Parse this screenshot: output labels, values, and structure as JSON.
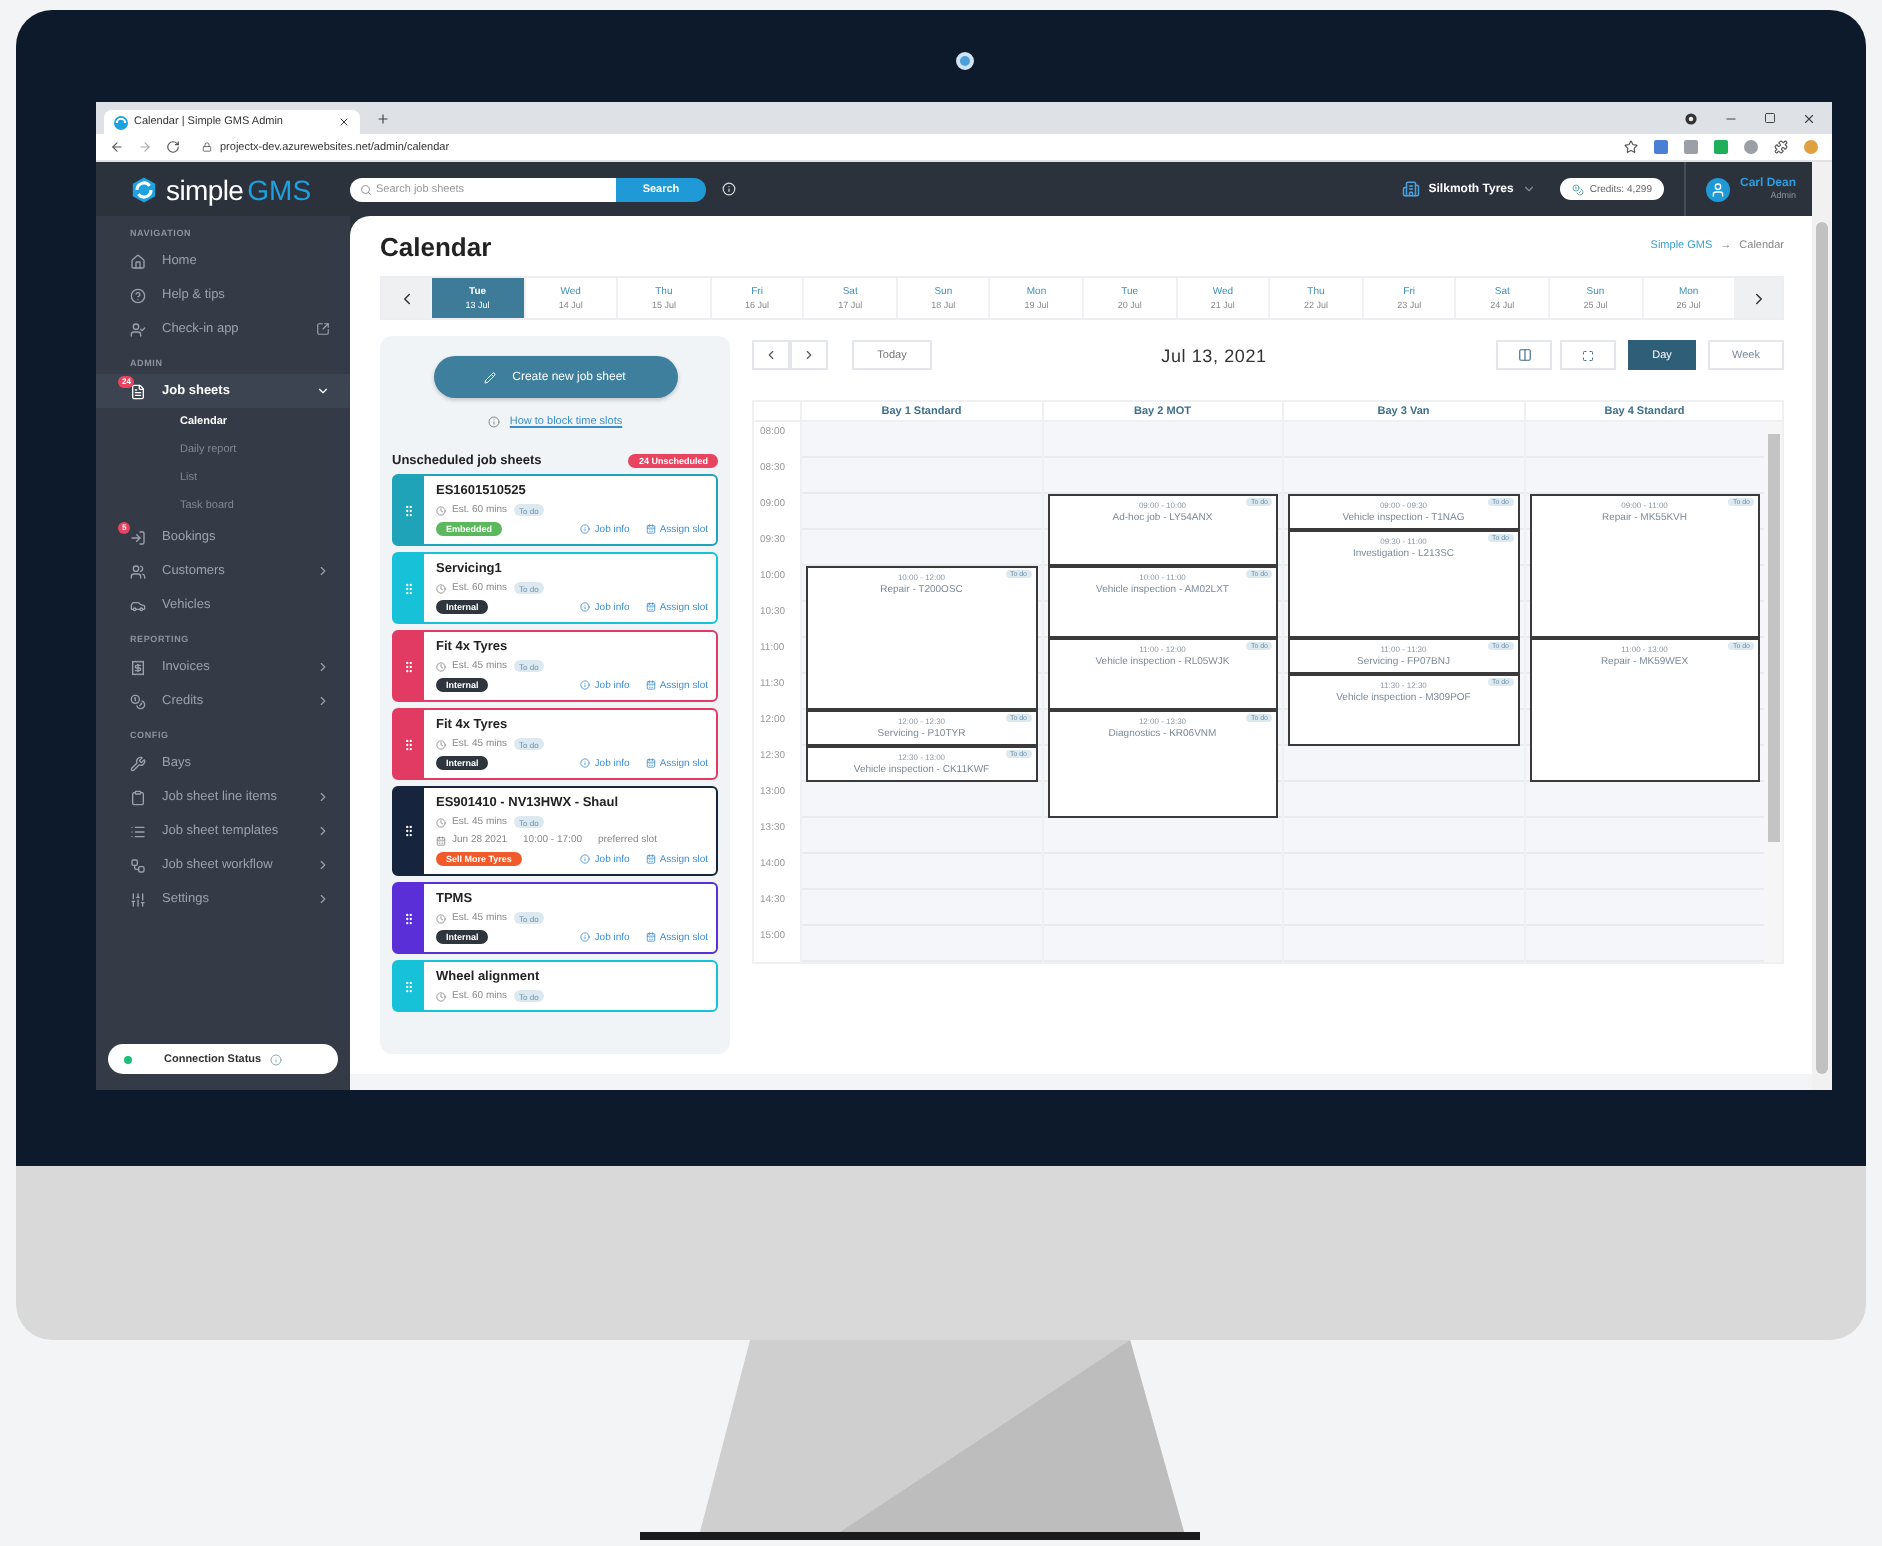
{
  "browser": {
    "tab_title": "Calendar | Simple GMS Admin",
    "url": "projectx-dev.azurewebsites.net/admin/calendar"
  },
  "header": {
    "logo_word": "simple",
    "logo_brand": "GMS",
    "search_placeholder": "Search job sheets",
    "search_button": "Search",
    "garage": "Silkmoth Tyres",
    "credits": "Credits: 4,299",
    "user_name": "Carl Dean",
    "user_role": "Admin"
  },
  "sidebar": {
    "sections": [
      {
        "title": "NAVIGATION",
        "items": [
          {
            "label": "Home",
            "selected": false
          },
          {
            "label": "Help & tips",
            "selected": false
          },
          {
            "label": "Check-in app",
            "selected": false
          }
        ]
      },
      {
        "title": "ADMIN",
        "items": [
          {
            "label": "Job sheets",
            "expanded": true,
            "selected": true,
            "badge": "24",
            "children": [
              {
                "label": "Calendar",
                "selected": true
              },
              {
                "label": "Daily report",
                "selected": false
              },
              {
                "label": "List",
                "selected": false
              },
              {
                "label": "Task board",
                "selected": false
              }
            ]
          },
          {
            "label": "Bookings",
            "selected": false,
            "badge": "5"
          },
          {
            "label": "Customers",
            "expanded": false,
            "selected": false
          },
          {
            "label": "Vehicles",
            "selected": false
          }
        ]
      },
      {
        "title": "REPORTING",
        "items": [
          {
            "label": "Invoices",
            "expanded": false,
            "selected": false
          },
          {
            "label": "Credits",
            "expanded": false,
            "selected": false
          }
        ]
      },
      {
        "title": "CONFIG",
        "items": [
          {
            "label": "Bays",
            "selected": false
          },
          {
            "label": "Job sheet line items",
            "expanded": false,
            "selected": false
          },
          {
            "label": "Job sheet templates",
            "expanded": false,
            "selected": false
          },
          {
            "label": "Job sheet workflow",
            "expanded": false,
            "selected": false
          },
          {
            "label": "Settings",
            "expanded": false,
            "selected": false
          }
        ]
      }
    ],
    "connection": "Connection Status"
  },
  "page": {
    "title": "Calendar",
    "breadcrumb": [
      "Simple GMS",
      "Calendar"
    ],
    "breadcrumb_separator": "→"
  },
  "dates": {
    "days": [
      {
        "weekday": "Tue",
        "date": "13 Jul",
        "selected": true
      },
      {
        "weekday": "Wed",
        "date": "14 Jul",
        "selected": false
      },
      {
        "weekday": "Thu",
        "date": "15 Jul",
        "selected": false
      },
      {
        "weekday": "Fri",
        "date": "16 Jul",
        "selected": false
      },
      {
        "weekday": "Sat",
        "date": "17 Jul",
        "selected": false
      },
      {
        "weekday": "Sun",
        "date": "18 Jul",
        "selected": false
      },
      {
        "weekday": "Mon",
        "date": "19 Jul",
        "selected": false
      },
      {
        "weekday": "Tue",
        "date": "20 Jul",
        "selected": false
      },
      {
        "weekday": "Wed",
        "date": "21 Jul",
        "selected": false
      },
      {
        "weekday": "Thu",
        "date": "22 Jul",
        "selected": false
      },
      {
        "weekday": "Fri",
        "date": "23 Jul",
        "selected": false
      },
      {
        "weekday": "Sat",
        "date": "24 Jul",
        "selected": false
      },
      {
        "weekday": "Sun",
        "date": "25 Jul",
        "selected": false
      },
      {
        "weekday": "Mon",
        "date": "26 Jul",
        "selected": false
      }
    ]
  },
  "planner": {
    "create_button": "Create new job sheet",
    "help_link": "How to block time slots",
    "title": "Unscheduled job sheets",
    "badge": "24 Unscheduled",
    "cards": [
      {
        "title": "ES1601510525",
        "color": "#1ea3b8",
        "estimate": "Est. 60 mins",
        "status": "To do",
        "tag": {
          "label": "Embedded",
          "color": "#5cb85c"
        },
        "info": "Job info",
        "assign": "Assign slot"
      },
      {
        "title": "Servicing1",
        "color": "#17c1d8",
        "estimate": "Est. 60 mins",
        "status": "To do",
        "tag": {
          "label": "Internal",
          "color": "#2f353d"
        },
        "info": "Job info",
        "assign": "Assign slot"
      },
      {
        "title": "Fit 4x Tyres",
        "color": "#e23b63",
        "estimate": "Est. 45 mins",
        "status": "To do",
        "tag": {
          "label": "Internal",
          "color": "#2f353d"
        },
        "info": "Job info",
        "assign": "Assign slot"
      },
      {
        "title": "Fit 4x Tyres",
        "color": "#e23b63",
        "estimate": "Est. 45 mins",
        "status": "To do",
        "tag": {
          "label": "Internal",
          "color": "#2f353d"
        },
        "info": "Job info",
        "assign": "Assign slot"
      },
      {
        "title": "ES901410 - NV13HWX - Shaul",
        "color": "#16243d",
        "estimate": "Est. 45 mins",
        "status": "To do",
        "preferred": {
          "date": "Jun 28 2021",
          "time": "10:00 - 17:00",
          "note": "preferred slot"
        },
        "tag": {
          "label": "Sell More Tyres",
          "color": "#f15a2b"
        },
        "info": "Job info",
        "assign": "Assign slot"
      },
      {
        "title": "TPMS",
        "color": "#5b2fd8",
        "estimate": "Est. 45 mins",
        "status": "To do",
        "tag": {
          "label": "Internal",
          "color": "#2f353d"
        },
        "info": "Job info",
        "assign": "Assign slot"
      },
      {
        "title": "Wheel alignment",
        "color": "#17c1d8",
        "estimate": "Est. 60 mins",
        "status": "To do"
      }
    ]
  },
  "calendar": {
    "today": "Today",
    "title": "Jul 13, 2021",
    "views": [
      {
        "label": "Day",
        "selected": true
      },
      {
        "label": "Week",
        "selected": false
      }
    ],
    "times": [
      "08:00",
      "08:30",
      "09:00",
      "09:30",
      "10:00",
      "10:30",
      "11:00",
      "11:30",
      "12:00",
      "12:30",
      "13:00",
      "13:30",
      "14:00",
      "14:30",
      "15:00"
    ],
    "bays": [
      {
        "name": "Bay 1 Standard",
        "events": [
          {
            "time": "10:00 - 12:00",
            "title": "Repair - T200OSC",
            "status": "To do"
          },
          {
            "time": "12:00 - 12:30",
            "title": "Servicing - P10TYR",
            "status": "To do"
          },
          {
            "time": "12:30 - 13:00",
            "title": "Vehicle inspection - CK11KWF",
            "status": "To do"
          }
        ]
      },
      {
        "name": "Bay 2 MOT",
        "events": [
          {
            "time": "09:00 - 10:00",
            "title": "Ad-hoc job - LY54ANX",
            "status": "To do"
          },
          {
            "time": "10:00 - 11:00",
            "title": "Vehicle inspection - AM02LXT",
            "status": "To do"
          },
          {
            "time": "11:00 - 12:00",
            "title": "Vehicle inspection - RL05WJK",
            "status": "To do"
          },
          {
            "time": "12:00 - 13:30",
            "title": "Diagnostics - KR06VNM",
            "status": "To do"
          }
        ]
      },
      {
        "name": "Bay 3 Van",
        "events": [
          {
            "time": "09:00 - 09:30",
            "title": "Vehicle inspection - T1NAG",
            "status": "To do"
          },
          {
            "time": "09:30 - 11:00",
            "title": "Investigation - L213SC",
            "status": "To do"
          },
          {
            "time": "11:00 - 11:30",
            "title": "Servicing - FP07BNJ",
            "status": "To do"
          },
          {
            "time": "11:30 - 12:30",
            "title": "Vehicle inspection - M309POF",
            "status": "To do"
          }
        ]
      },
      {
        "name": "Bay 4 Standard",
        "events": [
          {
            "time": "09:00 - 11:00",
            "title": "Repair - MK55KVH",
            "status": "To do"
          },
          {
            "time": "11:00 - 13:00",
            "title": "Repair - MK59WEX",
            "status": "To do"
          }
        ]
      }
    ]
  }
}
